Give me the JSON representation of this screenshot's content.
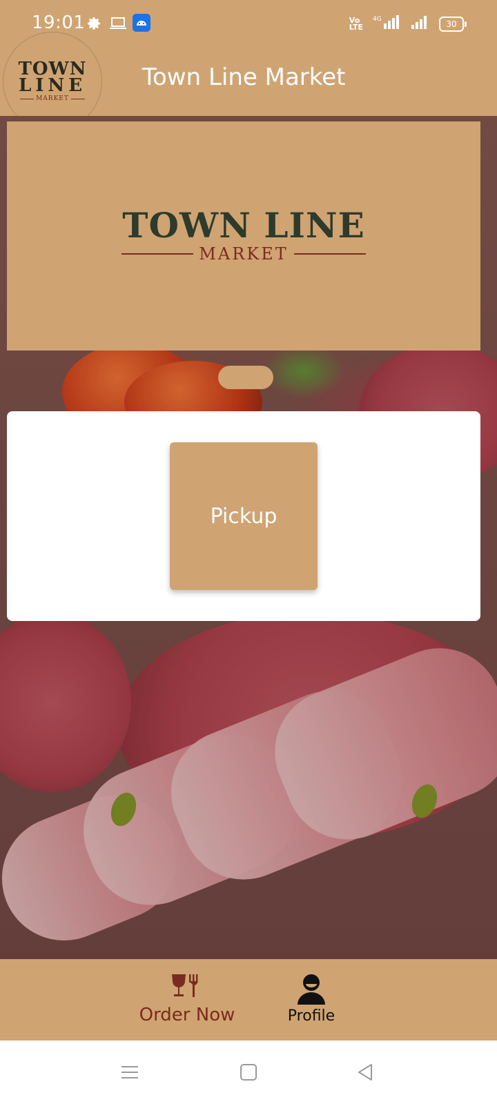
{
  "status_bar": {
    "time": "19:01",
    "network_label": "4G",
    "volte_label": "Vo\nLTE",
    "battery": "30",
    "icons": [
      "gear-icon",
      "laptop-icon",
      "android-icon",
      "volte-icon",
      "signal-4g-icon",
      "signal-icon",
      "battery-icon"
    ]
  },
  "app_bar": {
    "title": "Town Line Market",
    "logo": {
      "line1": "TOWN",
      "line2": "LINE",
      "sub": "MARKET"
    }
  },
  "banner": {
    "title": "TOWN LINE",
    "subtitle": "MARKET"
  },
  "card": {
    "pickup_label": "Pickup"
  },
  "bottom_nav": {
    "items": [
      {
        "label": "Order Now",
        "icon": "wine-fork-icon",
        "active": true
      },
      {
        "label": "Profile",
        "icon": "person-icon",
        "active": false
      }
    ]
  },
  "system_nav": {
    "icons": [
      "menu-icon",
      "home-square-icon",
      "back-triangle-icon"
    ]
  },
  "colors": {
    "brand": "#cfa472",
    "accent_dark": "#7a2b1e",
    "logo_text": "#2e3a2c",
    "white": "#ffffff"
  }
}
